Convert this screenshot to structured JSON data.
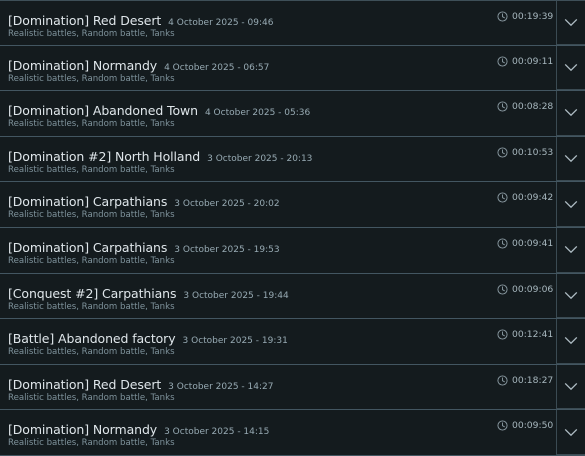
{
  "battles": [
    {
      "title": "[Domination] Red Desert",
      "date": "4 October 2025 - 09:46",
      "subtitle": "Realistic battles, Random battle, Tanks",
      "duration": "00:19:39"
    },
    {
      "title": "[Domination] Normandy",
      "date": "4 October 2025 - 06:57",
      "subtitle": "Realistic battles, Random battle, Tanks",
      "duration": "00:09:11"
    },
    {
      "title": "[Domination] Abandoned Town",
      "date": "4 October 2025 - 05:36",
      "subtitle": "Realistic battles, Random battle, Tanks",
      "duration": "00:08:28"
    },
    {
      "title": "[Domination #2] North Holland",
      "date": "3 October 2025 - 20:13",
      "subtitle": "Realistic battles, Random battle, Tanks",
      "duration": "00:10:53"
    },
    {
      "title": "[Domination] Carpathians",
      "date": "3 October 2025 - 20:02",
      "subtitle": "Realistic battles, Random battle, Tanks",
      "duration": "00:09:42"
    },
    {
      "title": "[Domination] Carpathians",
      "date": "3 October 2025 - 19:53",
      "subtitle": "Realistic battles, Random battle, Tanks",
      "duration": "00:09:41"
    },
    {
      "title": "[Conquest #2] Carpathians",
      "date": "3 October 2025 - 19:44",
      "subtitle": "Realistic battles, Random battle, Tanks",
      "duration": "00:09:06"
    },
    {
      "title": "[Battle] Abandoned factory",
      "date": "3 October 2025 - 19:31",
      "subtitle": "Realistic battles, Random battle, Tanks",
      "duration": "00:12:41"
    },
    {
      "title": "[Domination] Red Desert",
      "date": "3 October 2025 - 14:27",
      "subtitle": "Realistic battles, Random battle, Tanks",
      "duration": "00:18:27"
    },
    {
      "title": "[Domination] Normandy",
      "date": "3 October 2025 - 14:15",
      "subtitle": "Realistic battles, Random battle, Tanks",
      "duration": "00:09:50"
    }
  ],
  "icons": {
    "duration": "clock-icon",
    "expand": "chevron-down-icon"
  },
  "colors": {
    "background": "#141b1e",
    "separator": "#435661",
    "title": "#dfe6ea",
    "muted": "#7f939c"
  }
}
